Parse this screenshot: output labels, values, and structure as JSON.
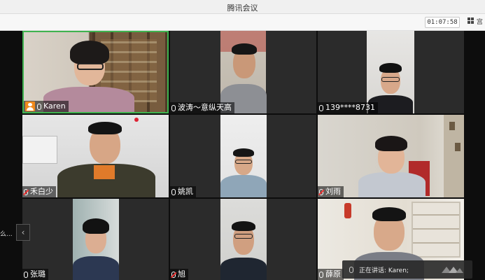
{
  "window": {
    "title": "腾讯会议"
  },
  "toolbar": {
    "timer": "01:07:58",
    "view_label": "宫"
  },
  "participants": [
    {
      "name": "Karen",
      "host": true,
      "muted": false
    },
    {
      "name": "波涛～意纵天高",
      "host": false,
      "muted": false
    },
    {
      "name": "139****8731",
      "host": false,
      "muted": false
    },
    {
      "name": "禾白少",
      "host": false,
      "muted": true
    },
    {
      "name": "姚凯",
      "host": false,
      "muted": false
    },
    {
      "name": "刘雨",
      "host": false,
      "muted": true
    },
    {
      "name": "张璐",
      "host": false,
      "muted": false
    },
    {
      "name": "旭",
      "host": false,
      "muted": true
    },
    {
      "name": "薛原",
      "host": false,
      "muted": false
    }
  ],
  "side_panel": {
    "text": "么..."
  },
  "speaking": {
    "text": "正在讲话: Karen;"
  },
  "colors": {
    "host_badge": "#f08a1c",
    "muted_mic": "#e33333",
    "active_border": "#3fb34f"
  }
}
